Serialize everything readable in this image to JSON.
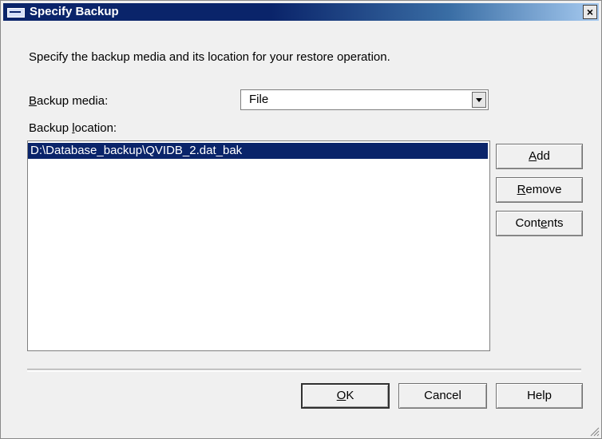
{
  "window": {
    "title": "Specify Backup",
    "close_label": "×"
  },
  "instruction": "Specify the backup media and its location for your restore operation.",
  "backup_media": {
    "label_pre": "",
    "label_accel": "B",
    "label_post": "ackup media:",
    "selected": "File"
  },
  "backup_location": {
    "label_pre": "Backup ",
    "label_accel": "l",
    "label_post": "ocation:",
    "items": [
      "D:\\Database_backup\\QVIDB_2.dat_bak"
    ]
  },
  "side_buttons": {
    "add": {
      "accel": "A",
      "rest": "dd"
    },
    "remove": {
      "accel": "R",
      "rest": "emove"
    },
    "contents": {
      "pre": "Cont",
      "accel": "e",
      "rest": "nts"
    }
  },
  "footer_buttons": {
    "ok": {
      "accel": "O",
      "rest": "K"
    },
    "cancel": "Cancel",
    "help": "Help"
  },
  "colors": {
    "title_bar": "#0a246a",
    "selection": "#0a246a",
    "dialog_bg": "#f0f0f0"
  }
}
